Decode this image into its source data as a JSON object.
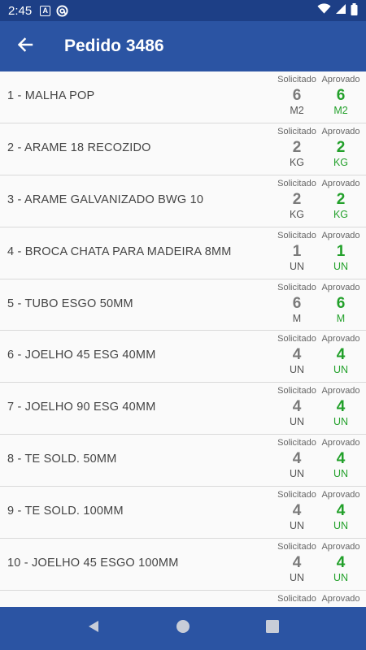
{
  "status_bar": {
    "time": "2:45",
    "icons": [
      "notification-a-icon",
      "at-sign-icon",
      "wifi-icon",
      "signal-icon",
      "battery-icon"
    ]
  },
  "app_bar": {
    "title": "Pedido 3486",
    "back_icon": "arrow-back-icon"
  },
  "columns": {
    "requested_label": "Solicitado",
    "approved_label": "Aprovado"
  },
  "items": [
    {
      "name": "1 - MALHA POP",
      "requested": "6",
      "approved": "6",
      "unit": "M2"
    },
    {
      "name": "2 - ARAME 18 RECOZIDO",
      "requested": "2",
      "approved": "2",
      "unit": "KG"
    },
    {
      "name": "3 - ARAME GALVANIZADO BWG 10",
      "requested": "2",
      "approved": "2",
      "unit": "KG"
    },
    {
      "name": "4 - BROCA CHATA PARA MADEIRA 8MM",
      "requested": "1",
      "approved": "1",
      "unit": "UN"
    },
    {
      "name": "5 - TUBO ESGO 50MM",
      "requested": "6",
      "approved": "6",
      "unit": "M"
    },
    {
      "name": "6 - JOELHO 45 ESG 40MM",
      "requested": "4",
      "approved": "4",
      "unit": "UN"
    },
    {
      "name": "7 - JOELHO 90 ESG 40MM",
      "requested": "4",
      "approved": "4",
      "unit": "UN"
    },
    {
      "name": "8 - TE SOLD. 50MM",
      "requested": "4",
      "approved": "4",
      "unit": "UN"
    },
    {
      "name": "9 - TE SOLD. 100MM",
      "requested": "4",
      "approved": "4",
      "unit": "UN"
    },
    {
      "name": "10 - JOELHO 45 ESGO 100MM",
      "requested": "4",
      "approved": "4",
      "unit": "UN"
    }
  ],
  "colors": {
    "primary": "#2b54a3",
    "status_bar": "#1d3f86",
    "approved": "#22a02a",
    "requested": "#7a7a7a"
  },
  "nav_bar": {
    "icons": [
      "back-triangle-icon",
      "home-circle-icon",
      "recents-square-icon"
    ]
  }
}
